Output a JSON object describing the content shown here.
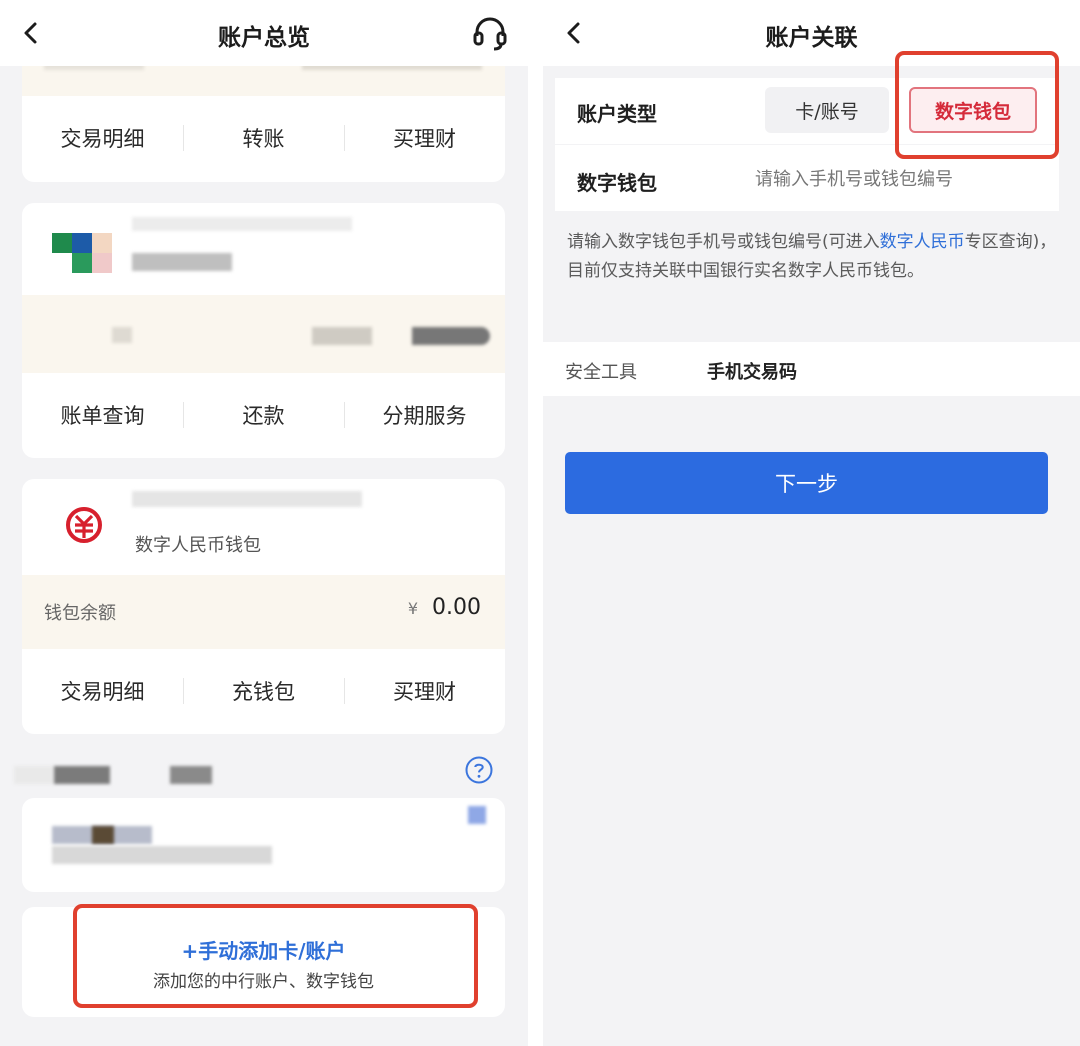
{
  "left": {
    "nav": {
      "title": "账户总览",
      "back_icon": "chevron-left-icon",
      "support_icon": "headset-icon"
    },
    "card1": {
      "actions": [
        "交易明细",
        "转账",
        "买理财"
      ]
    },
    "card2": {
      "actions": [
        "账单查询",
        "还款",
        "分期服务"
      ]
    },
    "card3": {
      "icon": "e-cny-icon",
      "name": "数字人民币钱包",
      "balance_label": "钱包余额",
      "currency": "¥",
      "balance": "0.00",
      "actions": [
        "交易明细",
        "充钱包",
        "买理财"
      ]
    },
    "help_icon": "question-circle-icon",
    "add": {
      "title": "+手动添加卡/账户",
      "subtitle": "添加您的中行账户、数字钱包"
    }
  },
  "right": {
    "nav": {
      "title": "账户关联",
      "back_icon": "chevron-left-icon"
    },
    "account_type": {
      "label": "账户类型",
      "options": [
        "卡/账号",
        "数字钱包"
      ],
      "selected": "数字钱包"
    },
    "wallet": {
      "label": "数字钱包",
      "placeholder": "请输入手机号或钱包编号"
    },
    "hint": {
      "before": "请输入数字钱包手机号或钱包编号(可进入",
      "link": "数字人民币",
      "after": "专区查询)，目前仅支持关联中国银行实名数字人民币钱包。"
    },
    "security": {
      "label": "安全工具",
      "value": "手机交易码"
    },
    "next_button": "下一步"
  },
  "colors": {
    "accent_blue": "#2c6be0",
    "highlight_red": "#e0402e",
    "wallet_red": "#d52b3a"
  }
}
